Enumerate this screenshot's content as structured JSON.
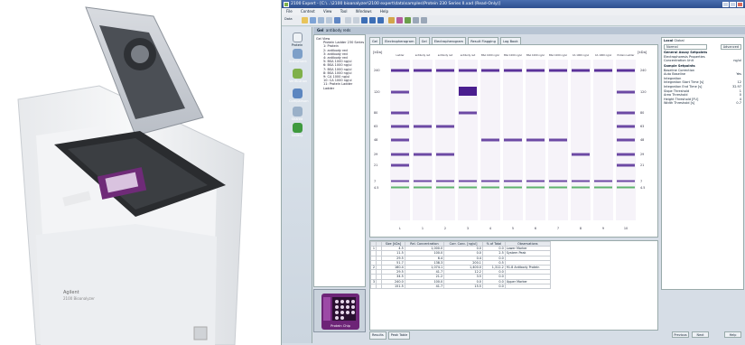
{
  "window": {
    "title": "2100 Expert - [C:\\...\\2100 bioanalyzer\\2100 expert\\data\\samples\\Protein 230 Series II.xad (Read-Only)]",
    "menu": [
      "File",
      "Context",
      "View",
      "Tool",
      "Windows",
      "Help"
    ],
    "context_label": "Data",
    "file_tab": "Gel",
    "file_tab_title": "antibody reds"
  },
  "nav": {
    "items": [
      "Protein",
      "Instrument",
      "Verification",
      "Comparison",
      "Shared",
      "Gallery"
    ]
  },
  "tree": {
    "root": "Gel View",
    "items": [
      "Protein Ladder 230 Series II.xad",
      "1: Protein",
      "2: antibody red",
      "3: antibody red",
      "4: antibody red",
      "5: BSA 1000 ng/ul",
      "6: BSA 1000 ng/ul",
      "7: BSA 1000 ng/ul",
      "8: BSA 1000 ng/ul",
      "9: CA 1000 ng/ul",
      "10: CA 1000 ng/ul",
      "11: Protein Ladder",
      "Ladder"
    ]
  },
  "gel": {
    "tabs": [
      "Gel",
      "Electropherogram",
      "Gel",
      "Electropherogram",
      "Result Flagging",
      "Log Book"
    ],
    "left_unit": "[kDa]",
    "right_unit": "[kDa]",
    "lane_headers": [
      "Ladder",
      "antibody red",
      "antibody red",
      "antibody red",
      "BSA 1000 ng/ul",
      "BSA 1000 ng/ul",
      "BSA 1000 ng/ul",
      "BSA 1000 ng/ul",
      "CA 1000 ng/ul",
      "CA 1000 ng/ul",
      "Protein Ladder"
    ],
    "lane_numbers": [
      "L",
      "1",
      "2",
      "3",
      "4",
      "5",
      "6",
      "7",
      "8",
      "9",
      "10"
    ],
    "ladder_left": [
      "240",
      "120",
      "80",
      "63",
      "48",
      "29",
      "21",
      "7",
      "4.5"
    ],
    "ladder_right": [
      "240",
      "120",
      "80",
      "63",
      "48",
      "29",
      "21",
      "7",
      "4.5"
    ]
  },
  "table": {
    "headers": [
      "",
      "",
      "Size [kDa]",
      "Rel. Concentration",
      "Corr. Conc. [ng/ul]",
      "% of Total",
      "Observations"
    ],
    "rows": [
      [
        "1",
        "",
        "4.5",
        "1,000.0",
        "0.0",
        "0.0",
        "Lower Marker"
      ],
      [
        "",
        "",
        "11.5",
        "100.0",
        "0.0",
        "2.5",
        "System Peak"
      ],
      [
        "",
        "",
        "29.5",
        "6.4",
        "0.4",
        "0.0",
        ""
      ],
      [
        "",
        "",
        "51.7",
        "138.3",
        "200.1",
        "0.5",
        ""
      ],
      [
        "2",
        "",
        "160.4",
        "1,074.1",
        "1,400.0",
        "1,312.2",
        "91.8 Antibody Protein"
      ],
      [
        "",
        "",
        "29.5",
        "41.7",
        "12.2",
        "0.0",
        ""
      ],
      [
        "",
        "",
        "34.5",
        "21.2",
        "3.5",
        "0.0",
        ""
      ],
      [
        "3",
        "",
        "240.0",
        "100.0",
        "0.0",
        "0.0",
        "Upper Marker"
      ],
      [
        "",
        "",
        "151.5",
        "41.7",
        "15.5",
        "0.0",
        ""
      ]
    ]
  },
  "bottom_tabs": [
    "Results",
    "Peak Table"
  ],
  "props": {
    "header_tabs": [
      "Local",
      "Global"
    ],
    "dropdown": "Normal",
    "advanced_label": "Advanced",
    "groups": [
      {
        "title": "General Assay Setpoints",
        "rows": [
          [
            "Electrophoresis Properties",
            ""
          ],
          [
            "Concentration Unit",
            "ng/ul"
          ]
        ]
      },
      {
        "title": "Sample Setpoints",
        "rows": [
          [
            "Baseline Correction",
            ""
          ],
          [
            "Auto Baseline",
            "Yes"
          ],
          [
            "Integration",
            ""
          ],
          [
            "Integration Start Time [s]",
            "12"
          ],
          [
            "Integration End Time [s]",
            "32.97"
          ],
          [
            "Slope Threshold",
            "1"
          ],
          [
            "Area Threshold",
            "0"
          ],
          [
            "Height Threshold [FU]",
            "4"
          ],
          [
            "Width Threshold [s]",
            "0.7"
          ]
        ]
      }
    ]
  },
  "buttons": {
    "previous": "Previous",
    "next": "Next",
    "help": "Help"
  },
  "instrument": {
    "brand": "Agilent",
    "model": "2100 Bioanalyzer"
  },
  "chip": {
    "label": "Protein Chip"
  },
  "colors": {
    "accent": "#2d4f8f",
    "band": "#4a1e8f",
    "green": "#7fb04a"
  }
}
